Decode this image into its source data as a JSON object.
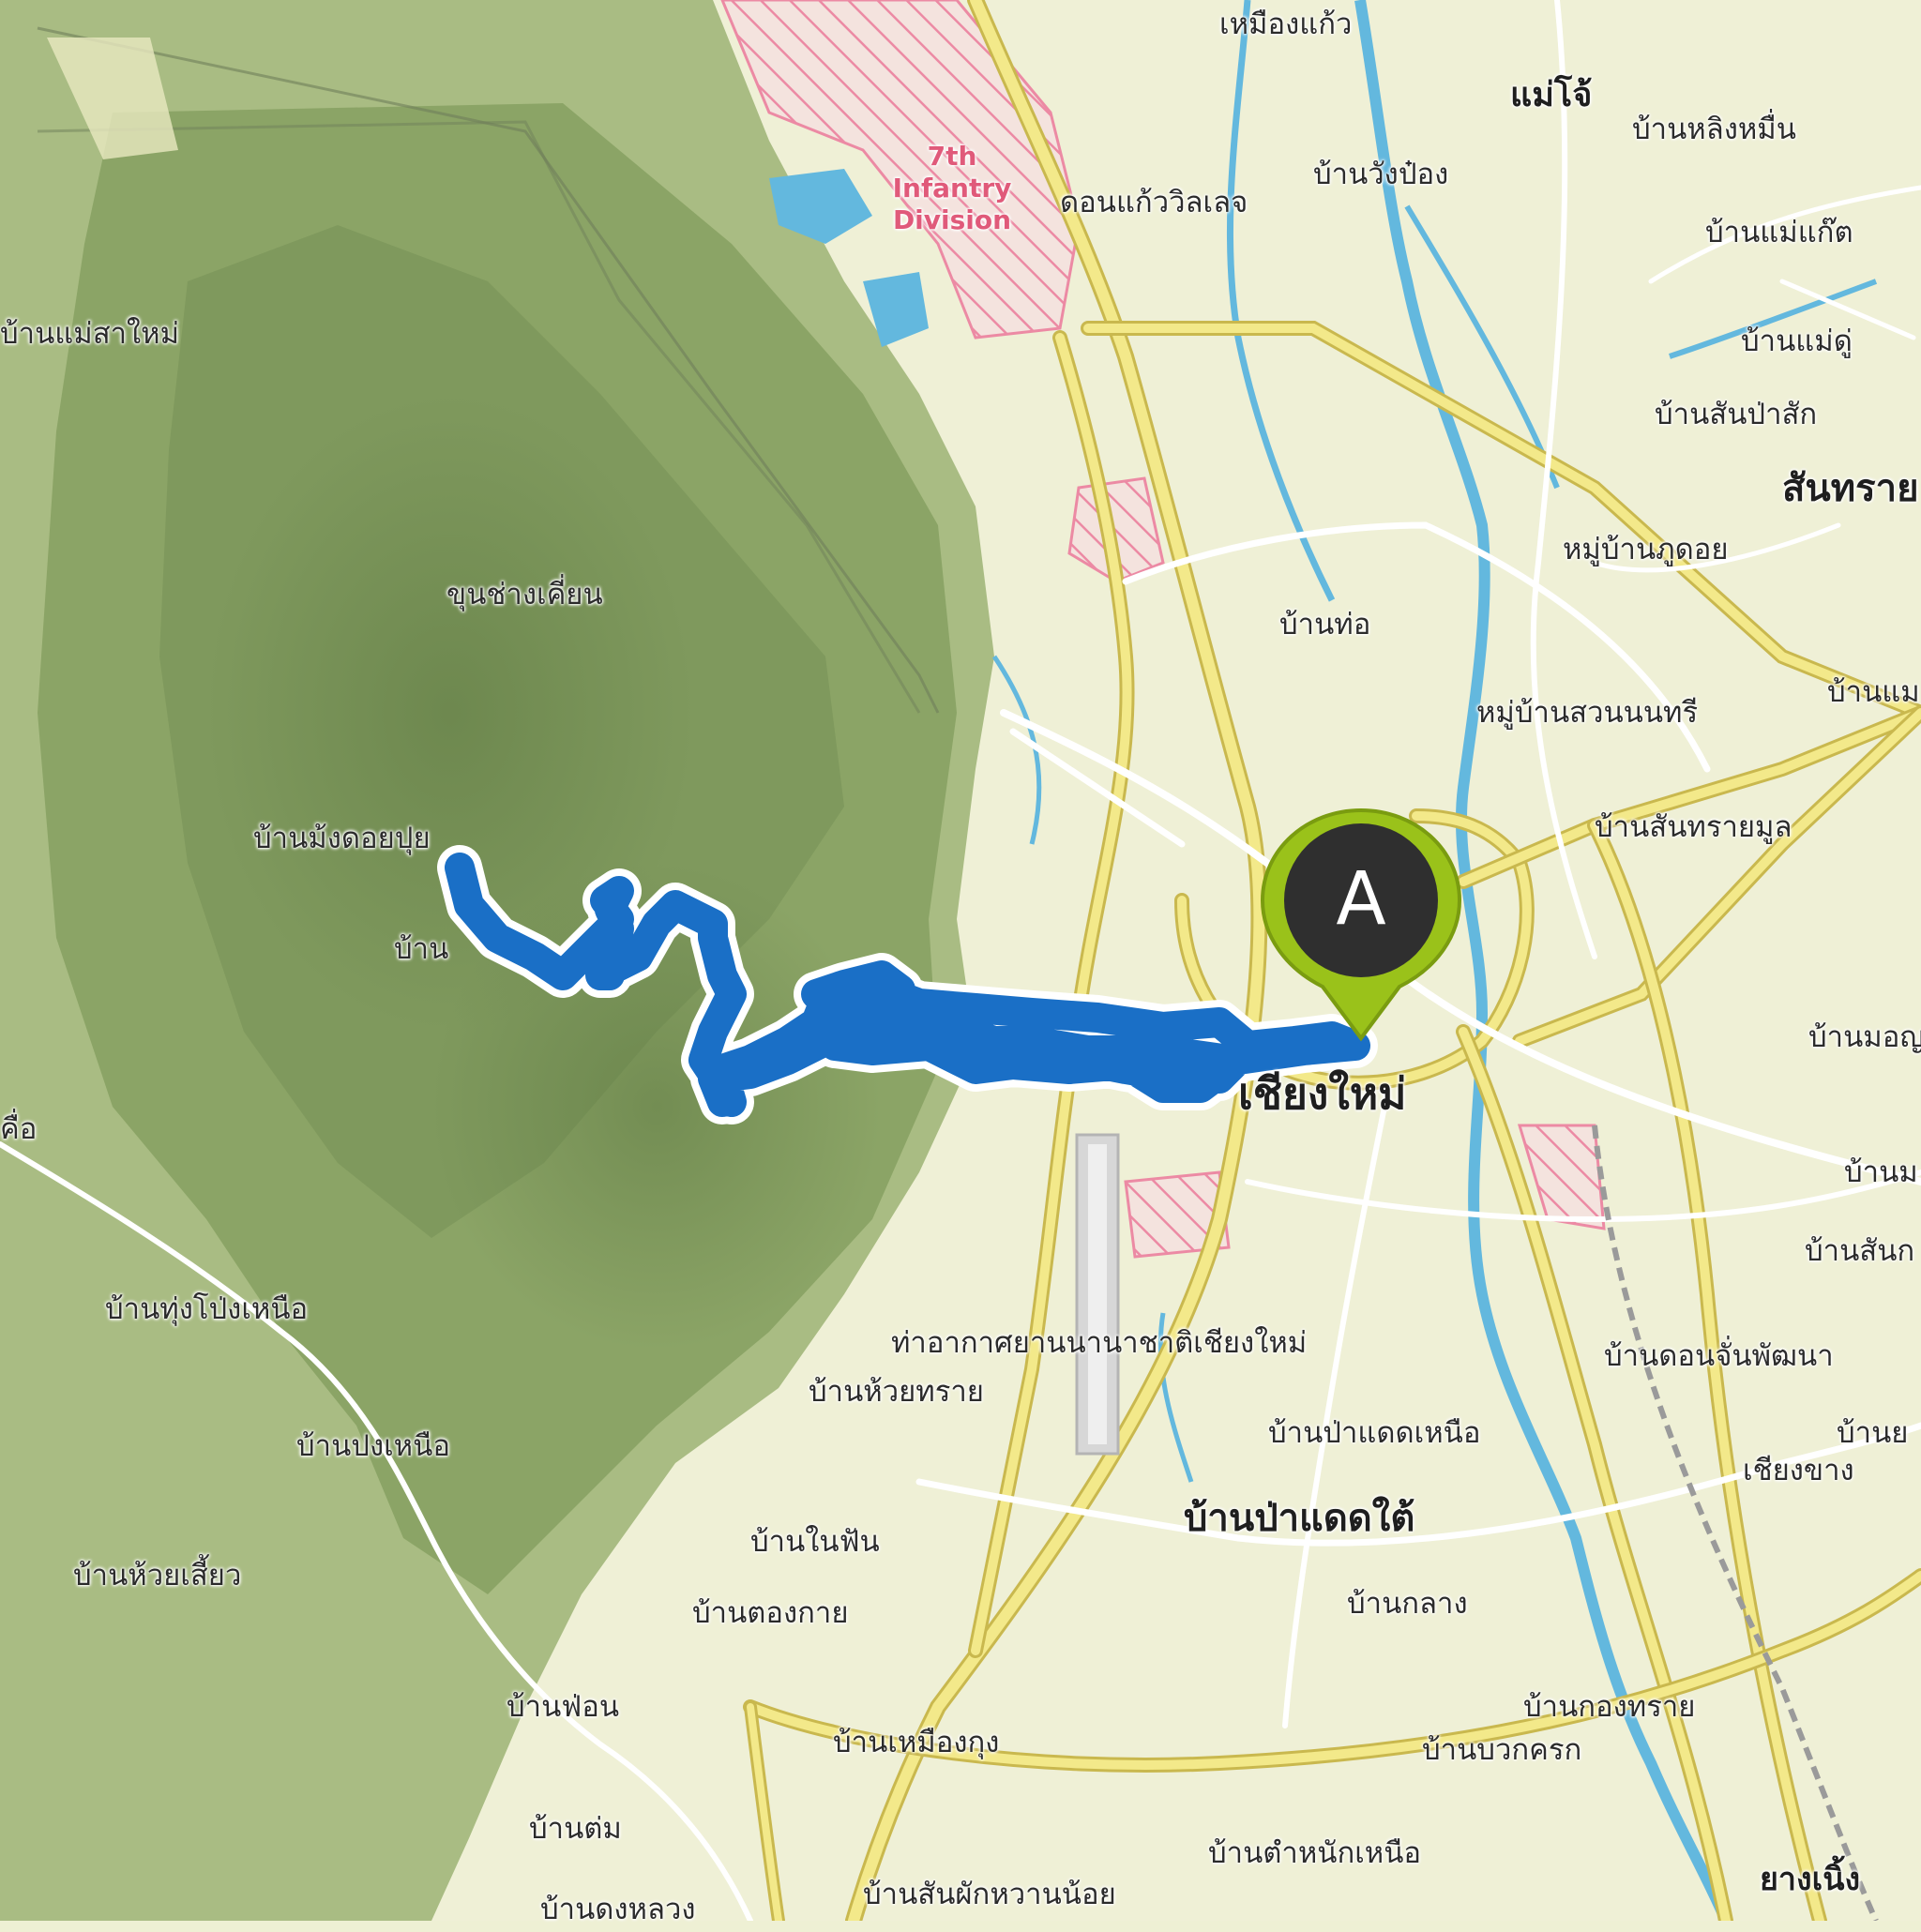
{
  "map": {
    "labels": {
      "mae_jo": "แม่โจ้",
      "ban_ling_muen": "บ้านหลิงหมื่น",
      "ban_wang_pong": "บ้านวังป๋อง",
      "don_kaew_village": "ดอนแก้ววิลเลจ",
      "ban_mae_kaet": "บ้านแม่แก๊ต",
      "ban_mae_sa_mai": "บ้านแม่สาใหม่",
      "ban_mae_du": "บ้านแม่ดู่",
      "ban_san_pa_sak": "บ้านสันป่าสัก",
      "san_sai": "สันทราย",
      "mu_ban_fu_doi": "หมู่บ้านภูดอย",
      "khun_chang_khian": "ขุนช่างเคี่ยน",
      "ban_tho": "บ้านท่อ",
      "mu_ban_suan_nonthri": "หมู่บ้านสวนนนทรี",
      "ban_mae_right": "บ้านแม",
      "ban_mong_doi_pui": "บ้านม้งดอยปุย",
      "ban_san_sai_mun": "บ้านสันทรายมูล",
      "ban_partial": "บ้าน",
      "ban_mon_right": "บ้านมอญ",
      "chiang_mai": "เชียงใหม่",
      "ban_m_right": "บ้านม",
      "ban_san_right": "บ้านสันก",
      "left_edge_a": "คื่อ",
      "ban_thung_pong_nuea": "บ้านทุ่งโป่งเหนือ",
      "airport": "ท่าอากาศยานนานาชาติเชียงใหม่",
      "ban_huai_sai": "บ้านห้วยทราย",
      "ban_don_chan_phatthana": "บ้านดอนจั่นพัฒนา",
      "ban_pong_nuea": "บ้านปงเหนือ",
      "ban_pa_daet_nuea": "บ้านป่าแดดเหนือ",
      "ban_y_right": "บ้านย",
      "chiang_khang": "เชียงขาง",
      "ban_pa_daet_tai": "บ้านป่าแดดใต้",
      "ban_nai_fan": "บ้านในฟัน",
      "ban_huai_liao": "บ้านห้วยเสี้ยว",
      "ban_tong_kai": "บ้านตองกาย",
      "ban_klang": "บ้านกลาง",
      "ban_fon": "บ้านฟ่อน",
      "ban_kong_sai": "บ้านกองทราย",
      "ban_nuea_ngung": "บ้านเหมืองกุง",
      "ban_bua_khrok": "บ้านบวกครก",
      "ban_dam": "บ้านต่ม",
      "ban_tamnak_nuea": "บ้านตำหนักเหนือ",
      "ban_san_phak_wan_noi": "บ้านสันผักหวานน้อย",
      "ban_dong_luang": "บ้านดงหลวง",
      "yang_noeng": "ยางเนิ้ง",
      "top_village": "เหมืองแก้ว",
      "infantry": "7th Infantry Division"
    },
    "marker": {
      "letter": "A",
      "color": "#9ac21a"
    },
    "colors": {
      "route": "#1a6fc6",
      "route_outline": "#ffffff",
      "road": "#f3e98a",
      "water": "#63b8de",
      "military": "#f19ab0"
    }
  }
}
